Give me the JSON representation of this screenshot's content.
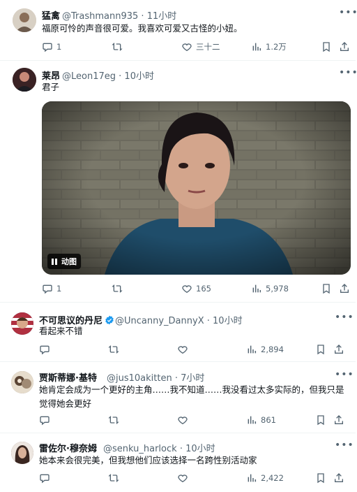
{
  "colors": {
    "accent": "#1d9bf0",
    "secondary_text": "#536471",
    "text": "#0f1419",
    "border": "#eff3f4"
  },
  "tweets": [
    {
      "name": "猛禽",
      "handle": "@Trashmann935",
      "time": "11小时",
      "text": "福原可怜的声音很可爱。我喜欢可爱又古怪的小妞。",
      "stats": {
        "reply": "1",
        "retweet": "",
        "like": "三十二",
        "views": "1.2万"
      }
    },
    {
      "name": "莱昂",
      "handle": "@Leon17eg",
      "time": "10小时",
      "text": "君子",
      "media_badge": "动图",
      "stats": {
        "reply": "1",
        "retweet": "",
        "like": "165",
        "views": "5,978"
      }
    },
    {
      "name": "不可思议的丹尼",
      "handle": "@Uncanny_DannyX",
      "time": "10小时",
      "verified": true,
      "text": "看起来不错",
      "stats": {
        "reply": "",
        "retweet": "",
        "like": "",
        "views": "2,894"
      }
    },
    {
      "name": "贾斯蒂娜·基特",
      "handle": "@jus10akitten",
      "time": "7小时",
      "text_lines": [
        "她肯定会成为一个更好的主角……我不知道……我没看过太多实际的，但我只是",
        "觉得她会更好"
      ],
      "stats": {
        "reply": "",
        "retweet": "",
        "like": "",
        "views": "861"
      }
    },
    {
      "name": "雷佐尔·穆奈姆",
      "handle": "@senku_harlock",
      "time": "10小时",
      "text": "她本来会很完美，但我想他们应该选择一名跨性别活动家",
      "stats": {
        "reply": "",
        "retweet": "",
        "like": "",
        "views": "2,422"
      }
    }
  ],
  "sep": "·"
}
